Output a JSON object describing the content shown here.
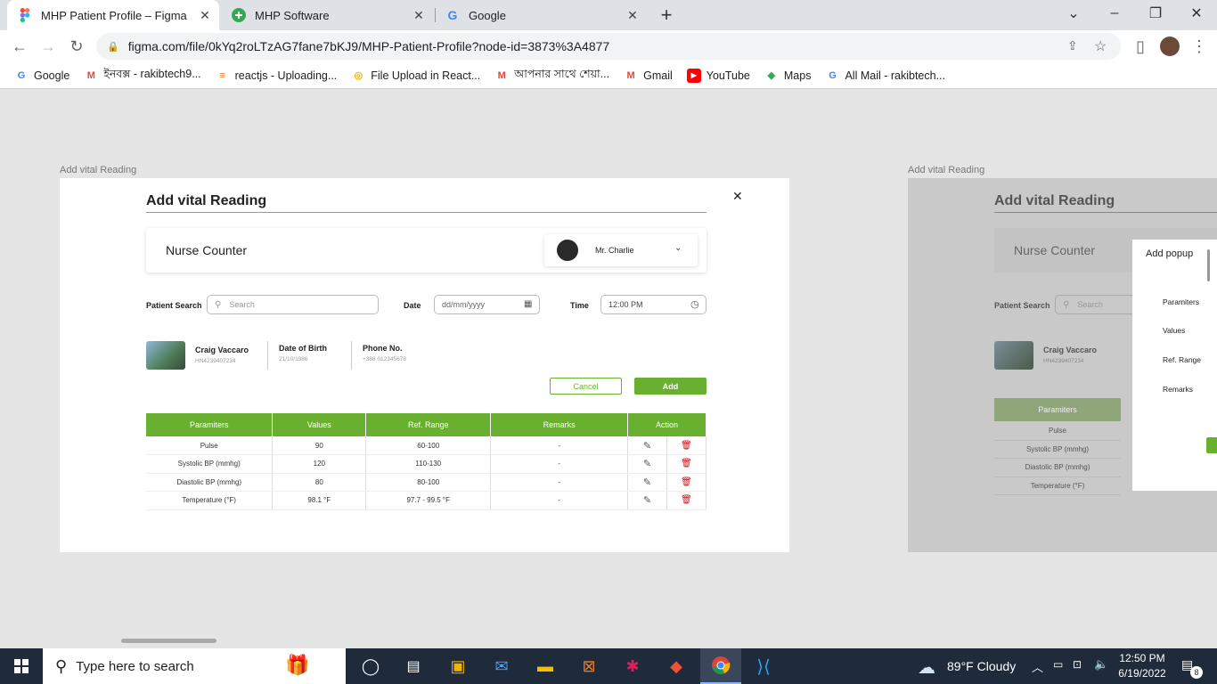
{
  "browser": {
    "tabs": [
      {
        "title": "MHP Patient Profile – Figma",
        "icon": "figma-icon"
      },
      {
        "title": "MHP Software",
        "icon": "plus-circle-icon"
      },
      {
        "title": "Google",
        "icon": "google-icon"
      }
    ],
    "url": "figma.com/file/0kYq2roLTzAG7fane7bKJ9/MHP-Patient-Profile?node-id=3873%3A4877",
    "bookmarks": [
      {
        "label": "Google",
        "icon": "google-icon"
      },
      {
        "label": "ইনবক্স - rakibtech9...",
        "icon": "gmail-icon"
      },
      {
        "label": "reactjs - Uploading...",
        "icon": "stackoverflow-icon"
      },
      {
        "label": "File Upload in React...",
        "icon": "bookmark-icon"
      },
      {
        "label": "আপনার সাথে শেয়া...",
        "icon": "gmail-icon"
      },
      {
        "label": "Gmail",
        "icon": "gmail-icon"
      },
      {
        "label": "YouTube",
        "icon": "youtube-icon"
      },
      {
        "label": "Maps",
        "icon": "maps-icon"
      },
      {
        "label": "All Mail - rakibtech...",
        "icon": "google-icon"
      }
    ]
  },
  "frame1": {
    "label": "Add vital Reading",
    "title": "Add vital Reading",
    "nurse_counter": "Nurse Counter",
    "doctor": "Mr. Charlie",
    "patient_search_label": "Patient Search",
    "search_placeholder": "Search",
    "date_label": "Date",
    "date_placeholder": "dd/mm/yyyy",
    "time_label": "Time",
    "time_value": "12:00 PM",
    "patient": {
      "name": "Craig Vaccaro",
      "id": "HN4239407234",
      "dob_label": "Date of Birth",
      "dob": "21/10/1986",
      "phone_label": "Phone No.",
      "phone": "+388 012345678"
    },
    "cancel": "Cancel",
    "add": "Add",
    "table": {
      "headers": [
        "Paramiters",
        "Values",
        "Ref. Range",
        "Remarks",
        "Action"
      ],
      "rows": [
        [
          "Pulse",
          "90",
          "60-100",
          "-"
        ],
        [
          "Systolic BP (mmhg)",
          "120",
          "110-130",
          "-"
        ],
        [
          "Diastolic BP (mmhg)",
          "80",
          "80-100",
          "-"
        ],
        [
          "Temperature (°F)",
          "98.1  °F",
          "97.7 - 99.5 °F",
          "-"
        ]
      ]
    }
  },
  "frame2": {
    "label": "Add vital Reading",
    "title": "Add vital Reading",
    "nurse_counter": "Nurse Counter",
    "patient_search_label": "Patient Search",
    "search_placeholder": "Search",
    "patient_name": "Craig Vaccaro",
    "patient_id": "HN4239407234",
    "table_header": "Paramiters",
    "rows": [
      "Pulse",
      "Systolic BP (mmhg)",
      "Diastolic BP (mmhg)",
      "Temperature (°F)"
    ],
    "popup": {
      "title": "Add popup",
      "fields": [
        "Paramiters",
        "Values",
        "Ref. Range",
        "Remarks"
      ]
    }
  },
  "taskbar": {
    "search_placeholder": "Type here to search",
    "weather": "89°F  Cloudy",
    "time": "12:50 PM",
    "date": "6/19/2022",
    "notification_count": "8"
  }
}
